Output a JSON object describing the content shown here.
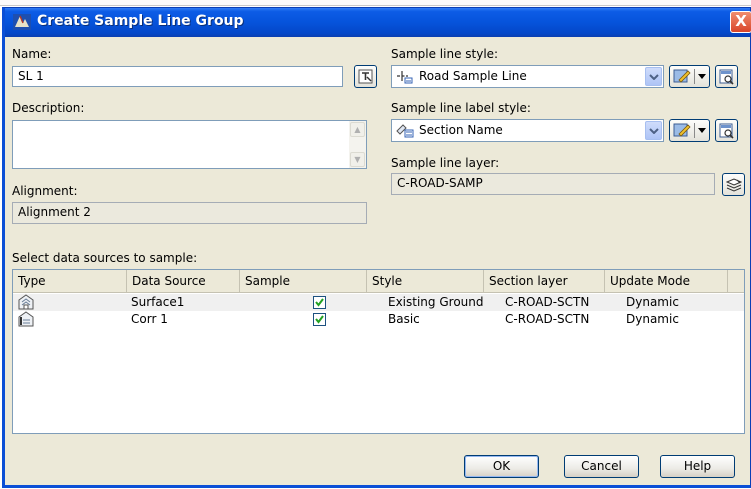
{
  "window": {
    "title": "Create Sample Line Group",
    "close_glyph": "X",
    "title_icon": "civil3d-app-icon"
  },
  "name": {
    "label": "Name:",
    "value": "SL 1",
    "picker_icon": "name-template-icon"
  },
  "description": {
    "label": "Description:",
    "value": ""
  },
  "alignment": {
    "label": "Alignment:",
    "value": "Alignment 2"
  },
  "sample_line_style": {
    "label": "Sample line style:",
    "value": "Road Sample Line",
    "icon": "sample-line-style-icon"
  },
  "sample_line_label_style": {
    "label": "Sample line label style:",
    "value": "Section Name",
    "icon": "label-style-icon"
  },
  "sample_line_layer": {
    "label": "Sample line layer:",
    "value": "C-ROAD-SAMP",
    "icon": "layer-icon"
  },
  "data_sources": {
    "label": "Select data sources to sample:",
    "columns": [
      "Type",
      "Data Source",
      "Sample",
      "Style",
      "Section layer",
      "Update Mode"
    ],
    "rows": [
      {
        "type_icon": "surface-icon",
        "data_source": "Surface1",
        "sample": true,
        "style": "Existing Ground",
        "section_layer": "C-ROAD-SCTN",
        "update_mode": "Dynamic"
      },
      {
        "type_icon": "corridor-icon",
        "data_source": "Corr 1",
        "sample": true,
        "style": "Basic",
        "section_layer": "C-ROAD-SCTN",
        "update_mode": "Dynamic"
      }
    ]
  },
  "buttons": {
    "ok": "OK",
    "cancel": "Cancel",
    "help": "Help"
  },
  "colors": {
    "titlebar": "#0653db",
    "dialog_bg": "#ece9d8",
    "close": "#d9452a",
    "check": "#21a121"
  }
}
